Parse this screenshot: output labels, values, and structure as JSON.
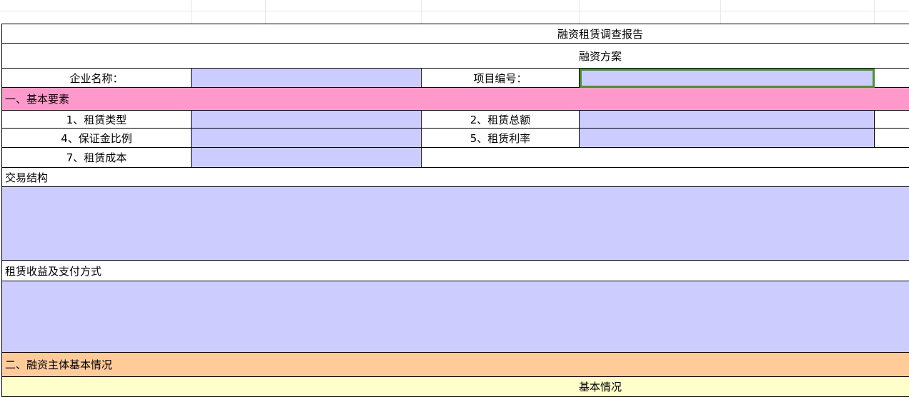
{
  "sheet": {
    "title": "融资租赁调查报告",
    "subtitle": "融资方案",
    "company_name_label": "企业名称：",
    "project_no_label": "项目编号：",
    "section1": "一、基本要素",
    "fields": {
      "f1": "1、租赁类型",
      "f2": "2、租赁总额",
      "f4": "4、保证金比例",
      "f5": "5、租赁利率",
      "f7": "7、租赁成本"
    },
    "transaction_label": "交易结构",
    "income_label": "租赁收益及支付方式",
    "section2": "二、融资主体基本情况",
    "basic_info": "基本情况"
  },
  "colors": {
    "input_fill": "#ccccff",
    "section1_fill": "#ff99cc",
    "section2_fill": "#ffcc99",
    "basic_info_fill": "#ffffcc",
    "selection_border": "#4a9134"
  }
}
